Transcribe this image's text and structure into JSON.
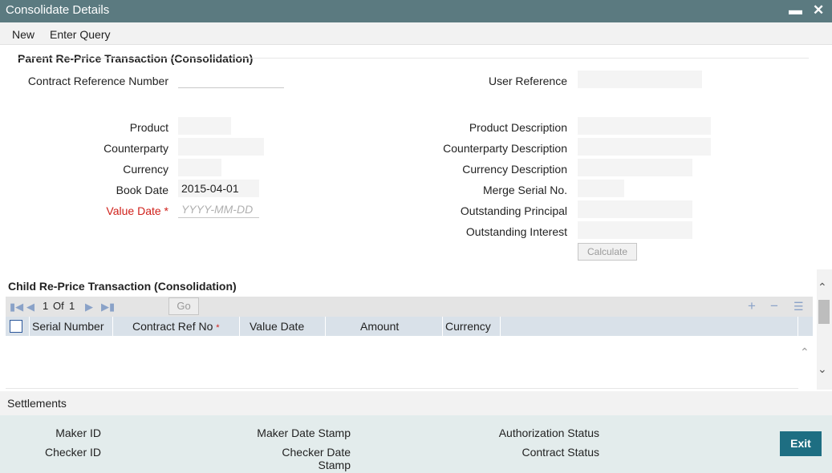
{
  "window": {
    "title": "Consolidate Details",
    "minimize": "▬",
    "close": "✕"
  },
  "menu": {
    "new": "New",
    "enter_query": "Enter Query"
  },
  "parent": {
    "section_title": "Parent Re-Price Transaction (Consolidation)",
    "contract_ref_label": "Contract Reference Number",
    "contract_ref_value": "",
    "user_ref_label": "User Reference",
    "user_ref_value": "",
    "product_label": "Product",
    "product_value": "",
    "product_desc_label": "Product Description",
    "counterparty_label": "Counterparty",
    "counterparty_desc_label": "Counterparty Description",
    "currency_label": "Currency",
    "currency_desc_label": "Currency Description",
    "book_date_label": "Book Date",
    "book_date_value": "2015-04-01",
    "merge_serial_label": "Merge Serial No.",
    "value_date_label": "Value Date",
    "value_date_required": "*",
    "value_date_placeholder": "YYYY-MM-DD",
    "outstanding_principal_label": "Outstanding Principal",
    "outstanding_interest_label": "Outstanding Interest",
    "calculate_label": "Calculate"
  },
  "child": {
    "section_title": "Child Re-Price Transaction (Consolidation)",
    "pager": {
      "current": "1",
      "of_label": "Of",
      "total": "1",
      "go_label": "Go"
    },
    "icons": {
      "first": "first-page-icon",
      "prev": "prev-page-icon",
      "next": "next-page-icon",
      "last": "last-page-icon",
      "add": "plus-icon",
      "remove": "minus-icon",
      "view": "list-view-icon"
    },
    "columns": {
      "serial_number": "Serial Number",
      "contract_ref_no": "Contract Ref No",
      "contract_ref_required": "*",
      "value_date": "Value Date",
      "amount": "Amount",
      "currency": "Currency"
    },
    "rows": []
  },
  "settlements": {
    "label": "Settlements"
  },
  "footer": {
    "maker_id": "Maker ID",
    "checker_id": "Checker ID",
    "maker_date_stamp": "Maker Date Stamp",
    "checker_date_line1": "Checker Date",
    "checker_date_line2": "Stamp",
    "authorization_status": "Authorization Status",
    "contract_status": "Contract Status",
    "exit": "Exit"
  },
  "colors": {
    "titlebar": "#5b7a80",
    "required": "#d0211b",
    "exit_button": "#1e6e82",
    "grid_header": "#d9e1e9",
    "footer": "#e3ecec"
  }
}
